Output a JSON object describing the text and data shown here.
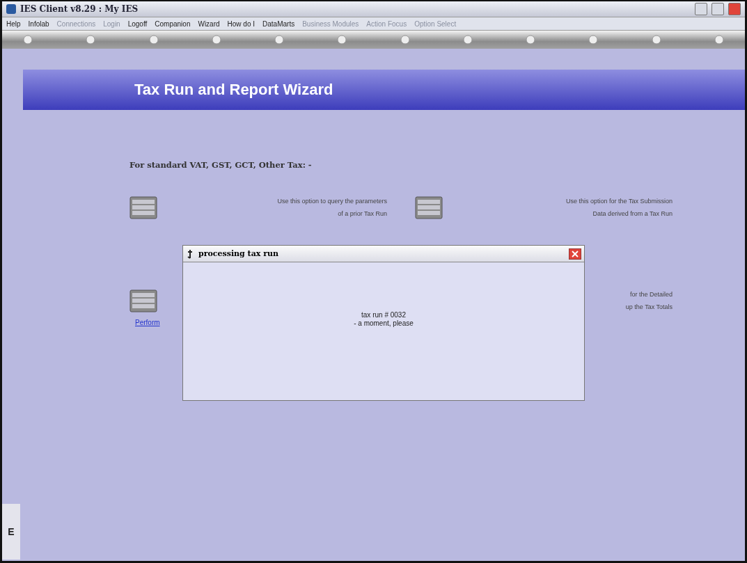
{
  "window": {
    "title": "IES Client v8.29 : My IES"
  },
  "menu": [
    {
      "label": "Help",
      "disabled": false
    },
    {
      "label": "Infolab",
      "disabled": false
    },
    {
      "label": "Connections",
      "disabled": true
    },
    {
      "label": "Login",
      "disabled": true
    },
    {
      "label": "Logoff",
      "disabled": false
    },
    {
      "label": "Companion",
      "disabled": false
    },
    {
      "label": "Wizard",
      "disabled": false
    },
    {
      "label": "How do I",
      "disabled": false
    },
    {
      "label": "DataMarts",
      "disabled": false
    },
    {
      "label": "Business Modules",
      "disabled": true
    },
    {
      "label": "Action Focus",
      "disabled": true
    },
    {
      "label": "Option Select",
      "disabled": true
    }
  ],
  "banner": {
    "title": "Tax Run and Report Wizard"
  },
  "heading": "For standard VAT, GST, GCT, Other Tax: -",
  "options": [
    {
      "icon": true,
      "lines": [
        "Use this option to query the parameters",
        "of a prior Tax Run"
      ]
    },
    {
      "icon": true,
      "lines": [
        "Use this option for the Tax Submission",
        "Data derived from a Tax Run"
      ]
    },
    {
      "icon": true,
      "link": "Perform"
    },
    {
      "lines": [
        "for the Detailed",
        "up the Tax Totals"
      ]
    }
  ],
  "side_panel": {
    "label": "E"
  },
  "dialog": {
    "title": "processing tax run",
    "lines": [
      "tax run # 0032",
      "- a moment, please"
    ]
  }
}
